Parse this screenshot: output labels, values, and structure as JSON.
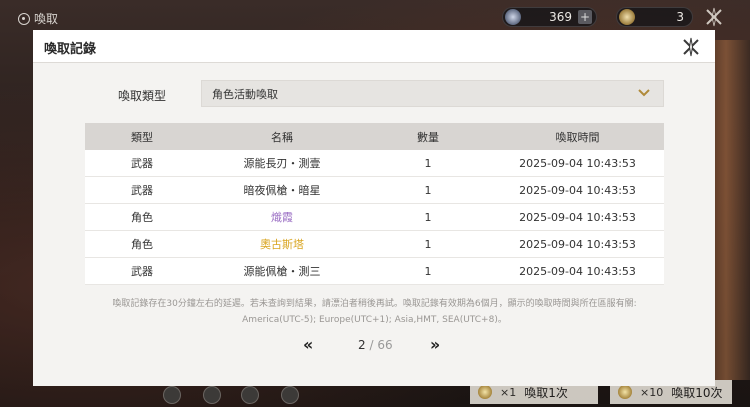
{
  "topbar": {
    "title": "喚取",
    "currency_primary": "369",
    "currency_secondary": "3"
  },
  "bottom": {
    "pull_one_count": "×1",
    "pull_one_label": "喚取1次",
    "pull_ten_count": "×10",
    "pull_ten_label": "喚取10次"
  },
  "modal": {
    "title": "喚取記錄",
    "type_label": "喚取類型",
    "type_selected": "角色活動喚取",
    "columns": [
      "類型",
      "名稱",
      "數量",
      "喚取時間"
    ],
    "rows": [
      {
        "type": "武器",
        "name": "源能長刃・測壹",
        "qty": "1",
        "time": "2025-09-04 10:43:53",
        "rarity": "normal"
      },
      {
        "type": "武器",
        "name": "暗夜佩槍・暗星",
        "qty": "1",
        "time": "2025-09-04 10:43:53",
        "rarity": "normal"
      },
      {
        "type": "角色",
        "name": "熾霞",
        "qty": "1",
        "time": "2025-09-04 10:43:53",
        "rarity": "purple"
      },
      {
        "type": "角色",
        "name": "奧古斯塔",
        "qty": "1",
        "time": "2025-09-04 10:43:53",
        "rarity": "gold"
      },
      {
        "type": "武器",
        "name": "源能佩槍・測三",
        "qty": "1",
        "time": "2025-09-04 10:43:53",
        "rarity": "normal"
      }
    ],
    "footnote_line1": "喚取記錄存在30分鐘左右的延遲。若未查詢到結果，請漂泊者稍後再試。喚取記錄有效期為6個月，顯示的喚取時間與所在區服有關:",
    "footnote_line2": "America(UTC-5); Europe(UTC+1); Asia,HMT, SEA(UTC+8)。",
    "pager": {
      "prev": "‹‹",
      "next": "››",
      "current": "2",
      "separator": "/",
      "total": "66"
    }
  },
  "colors": {
    "rarity_purple": "#9b6fc4",
    "rarity_gold": "#d9a520"
  }
}
